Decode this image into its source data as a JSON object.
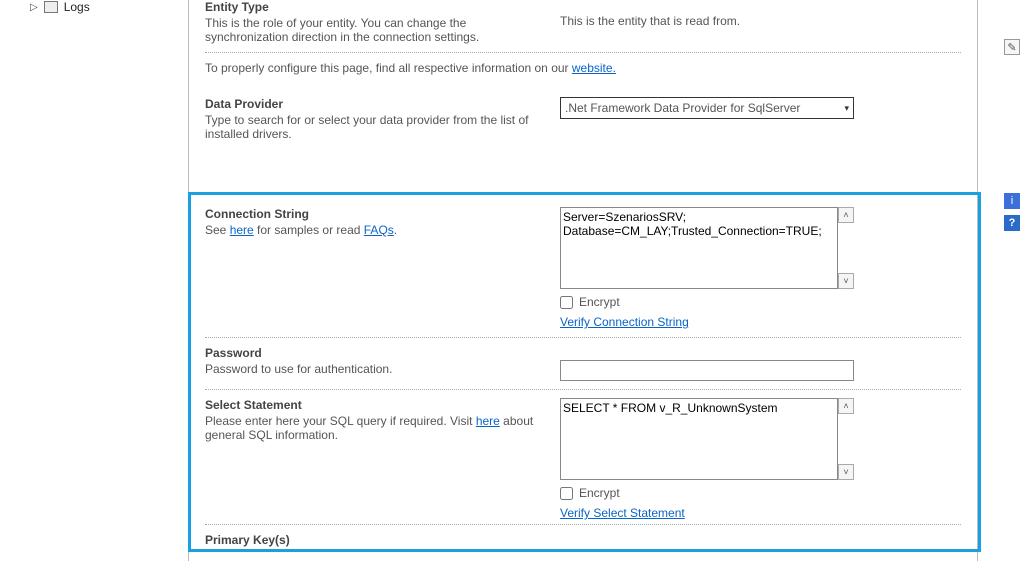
{
  "tree": {
    "logs_label": "Logs"
  },
  "entity": {
    "title": "Entity Type",
    "desc": "This is the role of your entity. You can change the synchronization direction in the connection settings.",
    "readonly": "This is the entity that is read from."
  },
  "config_note": {
    "prefix": "To properly configure this page, find all respective information on our ",
    "link": "website.",
    "suffix": ""
  },
  "provider": {
    "title": "Data Provider",
    "desc": "Type to search for or select your data provider from the list of installed drivers.",
    "selected": ".Net Framework Data Provider for SqlServer"
  },
  "conn": {
    "title": "Connection String",
    "desc_prefix": "See ",
    "desc_link1": "here",
    "desc_mid": " for samples or read ",
    "desc_link2": "FAQs",
    "desc_suffix": ".",
    "value": "Server=SzenariosSRV;\nDatabase=CM_LAY;Trusted_Connection=TRUE;",
    "encrypt": "Encrypt",
    "verify": "Verify Connection String"
  },
  "password": {
    "title": "Password",
    "desc": "Password to use for authentication.",
    "value": ""
  },
  "select": {
    "title": "Select Statement",
    "desc_prefix": "Please enter here your SQL query if required. Visit ",
    "desc_link": "here",
    "desc_suffix": " about general SQL information.",
    "value": "SELECT * FROM v_R_UnknownSystem",
    "encrypt": "Encrypt",
    "verify": "Verify Select Statement"
  },
  "primary": {
    "title": "Primary Key(s)"
  },
  "icons": {
    "edit": "✎",
    "info": "i",
    "help": "?"
  }
}
